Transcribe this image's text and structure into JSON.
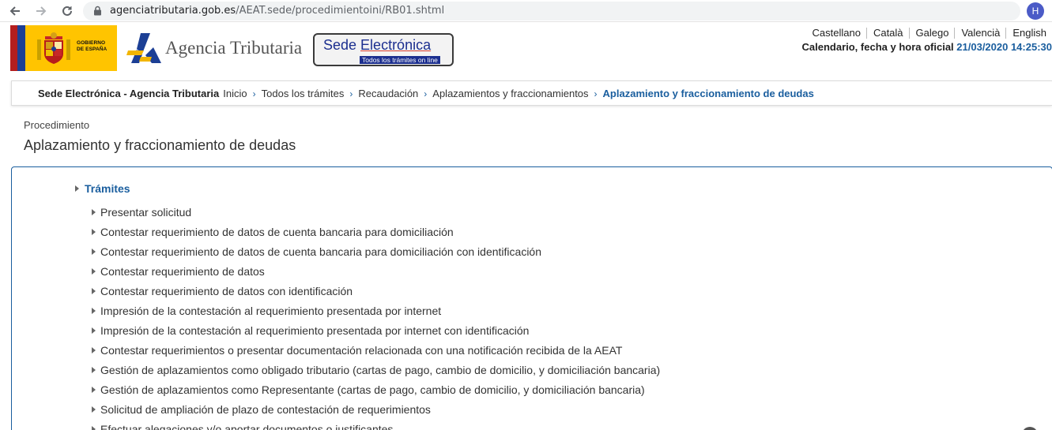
{
  "browser": {
    "url_host": "agenciatributaria.gob.es",
    "url_path": "/AEAT.sede/procedimientoini/RB01.shtml",
    "profile_initial": "H",
    "icons": [
      "back-arrow-icon",
      "forward-arrow-icon",
      "reload-icon",
      "lock-icon",
      "star-icon"
    ]
  },
  "header": {
    "gobierno_text": "GOBIERNO\nDE ESPAÑA",
    "agency_name": "Agencia Tributaria",
    "sede_title_a": "Sede ",
    "sede_title_b": "Electrónica",
    "sede_subtitle": "Todos los trámites on line",
    "languages": [
      "Castellano",
      "Català",
      "Galego",
      "Valencià",
      "English"
    ],
    "calendar_label": "Calendario, fecha y hora oficial ",
    "calendar_datetime": "21/03/2020 14:25:30"
  },
  "breadcrumb": {
    "site": "Sede Electrónica - Agencia Tributaria",
    "items": [
      "Inicio",
      "Todos los trámites",
      "Recaudación",
      "Aplazamientos y fraccionamientos"
    ],
    "current": "Aplazamiento y fraccionamiento de deudas"
  },
  "page": {
    "label": "Procedimiento",
    "title": "Aplazamiento y fraccionamiento de deudas"
  },
  "tramites": {
    "heading": "Trámites",
    "items": [
      "Presentar solicitud",
      "Contestar requerimiento de datos de cuenta bancaria para domiciliación",
      "Contestar requerimiento de datos de cuenta bancaria para domiciliación con identificación",
      "Contestar requerimiento de datos",
      "Contestar requerimiento de datos con identificación",
      "Impresión de la contestación al requerimiento presentada por internet",
      "Impresión de la contestación al requerimiento presentada por internet con identificación",
      "Contestar requerimientos o presentar documentación relacionada con una notificación recibida de la AEAT",
      "Gestión de aplazamientos como obligado tributario (cartas de pago, cambio de domicilio, y domiciliación bancaria)",
      "Gestión de aplazamientos como Representante (cartas de pago, cambio de domicilio, y domiciliación bancaria)",
      "Solicitud de ampliación de plazo de contestación de requerimientos",
      "Efectuar alegaciones y/o aportar documentos o justificantes"
    ]
  },
  "colors": {
    "link_blue": "#1a5e9e",
    "gob_yellow": "#ffc400",
    "sede_blue": "#1c2f8f"
  }
}
